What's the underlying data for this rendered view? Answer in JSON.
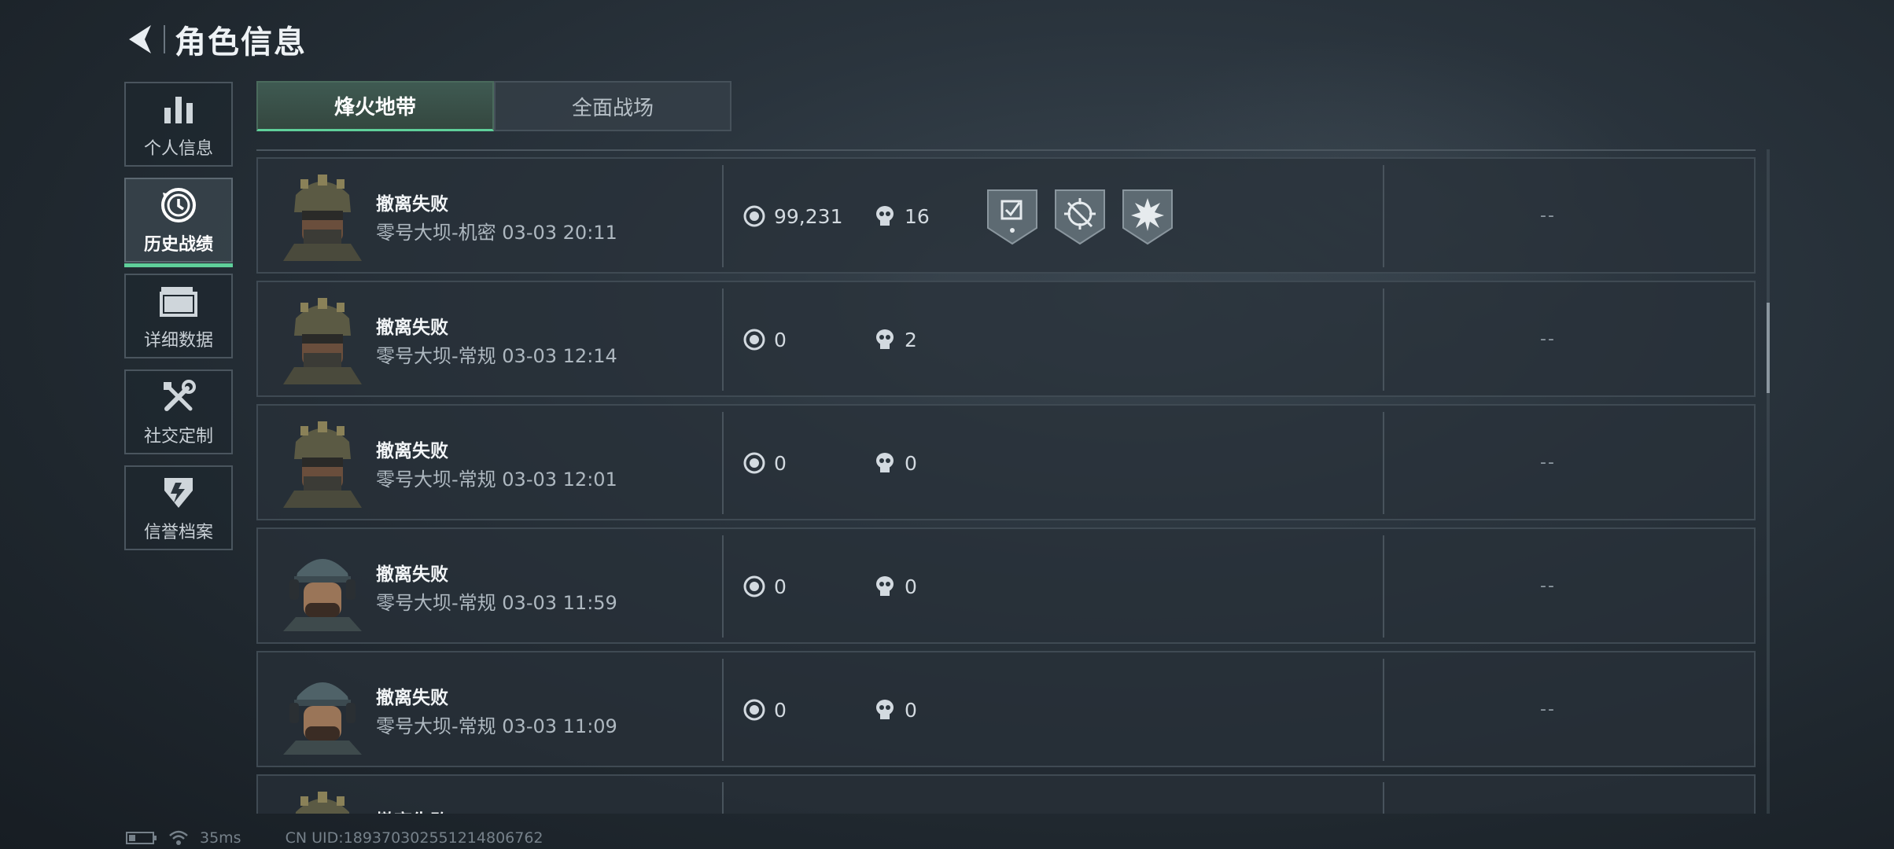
{
  "header": {
    "title": "角色信息"
  },
  "sidebar": {
    "items": [
      {
        "label": "个人信息",
        "icon": "bar-chart-icon"
      },
      {
        "label": "历史战绩",
        "icon": "history-clock-icon"
      },
      {
        "label": "详细数据",
        "icon": "folder-icon"
      },
      {
        "label": "社交定制",
        "icon": "tools-icon"
      },
      {
        "label": "信誉档案",
        "icon": "shield-icon"
      }
    ],
    "active_index": 1
  },
  "tabs": [
    {
      "label": "烽火地带",
      "active": true
    },
    {
      "label": "全面战场",
      "active": false
    }
  ],
  "records": [
    {
      "result": "撤离失败",
      "map": "零号大坝-机密 03-03 20:11",
      "coins": "99,231",
      "kills": "16",
      "badges": [
        "medal-badge-icon",
        "target-badge-icon",
        "explosion-badge-icon"
      ],
      "extra": "--",
      "avatar": "tactical-helmet-operator"
    },
    {
      "result": "撤离失败",
      "map": "零号大坝-常规 03-03 12:14",
      "coins": "0",
      "kills": "2",
      "badges": [],
      "extra": "--",
      "avatar": "tactical-helmet-operator"
    },
    {
      "result": "撤离失败",
      "map": "零号大坝-常规 03-03 12:01",
      "coins": "0",
      "kills": "0",
      "badges": [],
      "extra": "--",
      "avatar": "tactical-helmet-operator"
    },
    {
      "result": "撤离失败",
      "map": "零号大坝-常规 03-03 11:59",
      "coins": "0",
      "kills": "0",
      "badges": [],
      "extra": "--",
      "avatar": "cap-headset-operator"
    },
    {
      "result": "撤离失败",
      "map": "零号大坝-常规 03-03 11:09",
      "coins": "0",
      "kills": "0",
      "badges": [],
      "extra": "--",
      "avatar": "cap-headset-operator"
    },
    {
      "result": "撤离失败",
      "map": "",
      "coins": "",
      "kills": "",
      "badges": [],
      "extra": "",
      "avatar": "tactical-helmet-operator"
    }
  ],
  "footer": {
    "ping": "35ms",
    "uid": "CN UID:18937030255121480​6762"
  },
  "colors": {
    "accent": "#5fcf9a",
    "background": "#242d35"
  }
}
